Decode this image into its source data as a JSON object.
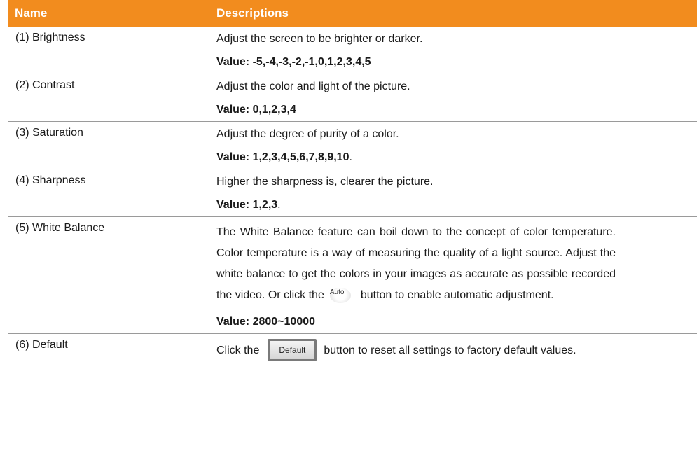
{
  "header": {
    "name": "Name",
    "descriptions": "Descriptions"
  },
  "rows": [
    {
      "name": "(1) Brightness",
      "desc": "Adjust the screen to be brighter or darker.",
      "value": "Value: -5,-4,-3,-2,-1,0,1,2,3,4,5",
      "value_tail": ""
    },
    {
      "name": "(2) Contrast",
      "desc": "Adjust the color and light of the picture.",
      "value": "Value: 0,1,2,3,4",
      "value_tail": ""
    },
    {
      "name": "(3) Saturation",
      "desc": "Adjust the degree of purity of a color.",
      "value": "Value: 1,2,3,4,5,6,7,8,9,10",
      "value_tail": "."
    },
    {
      "name": "(4) Sharpness",
      "desc": "Higher the sharpness is, clearer the picture.",
      "value": "Value: 1,2,3",
      "value_tail": "."
    },
    {
      "name": "(5) White Balance",
      "desc_before": "The White Balance feature can boil down to the concept of color temperature. Color temperature is a way of measuring the quality of a light source. Adjust the white balance to get the colors in your images as accurate as possible recorded the video. Or click the",
      "button_label": "Auto",
      "desc_after": "button to enable automatic adjustment.",
      "value": "Value: 2800~10000"
    },
    {
      "name": "(6) Default",
      "desc_before": "Click the",
      "button_label": "Default",
      "desc_after": "button to reset all settings to factory default values."
    }
  ]
}
